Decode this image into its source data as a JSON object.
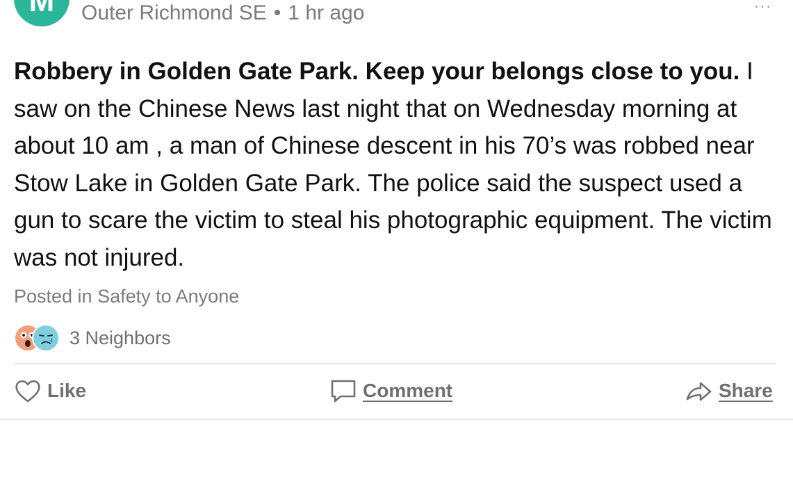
{
  "post": {
    "author_initial": "M",
    "location": "Outer Richmond SE",
    "separator": "•",
    "time": "1 hr ago",
    "more_glyph": "...",
    "title": "Robbery in Golden Gate Park. Keep your belongs close to you.",
    "body": "I saw on the Chinese News last night that on Wednesday morning at about 10 am , a man of Chinese descent in his 70’s was robbed near Stow Lake in Golden Gate Park. The police said the suspect used a gun to scare the victim to steal his photographic equipment. The victim was not injured.",
    "posted_in": "Posted in Safety to Anyone",
    "reactions": {
      "icons": [
        "surprised-face-icon",
        "crying-face-icon"
      ],
      "count_label": "3 Neighbors"
    }
  },
  "actions": {
    "like": "Like",
    "comment": "Comment",
    "share": "Share"
  },
  "colors": {
    "avatar": "#2bb59a",
    "muted_text": "#7b7b7b",
    "body_text": "#111111",
    "wow_reaction": "#f0a07a",
    "sad_reaction": "#7fd0df"
  }
}
